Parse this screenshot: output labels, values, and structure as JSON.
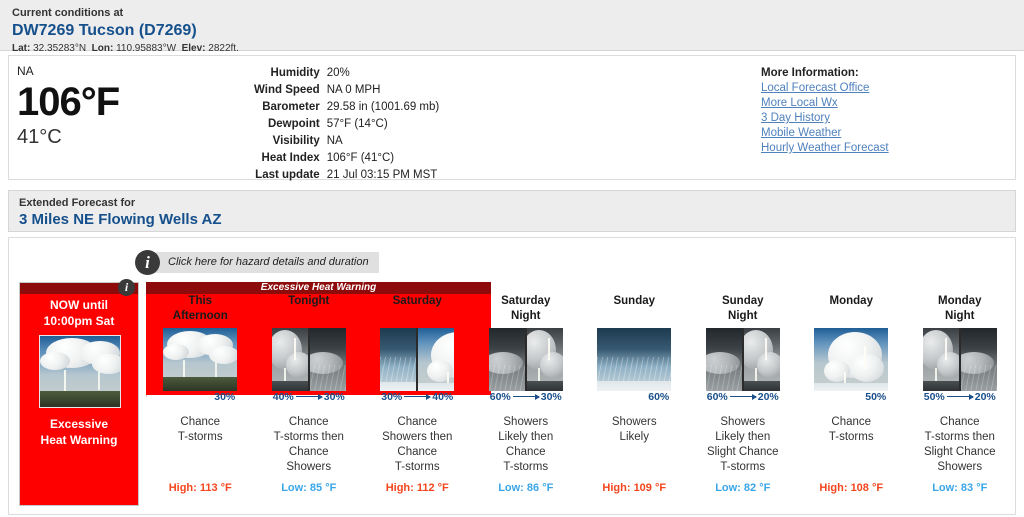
{
  "current": {
    "header_label": "Current conditions at",
    "station": "DW7269 Tucson (D7269)",
    "lat_key": "Lat:",
    "lat_val": "32.35283°N",
    "lon_key": "Lon:",
    "lon_val": "110.95883°W",
    "elev_key": "Elev:",
    "elev_val": "2822ft.",
    "sky": "NA",
    "temp_f": "106°F",
    "temp_c": "41°C",
    "rows": [
      {
        "key": "Humidity",
        "value": "20%"
      },
      {
        "key": "Wind Speed",
        "value": "NA 0 MPH"
      },
      {
        "key": "Barometer",
        "value": "29.58 in (1001.69 mb)"
      },
      {
        "key": "Dewpoint",
        "value": "57°F (14°C)"
      },
      {
        "key": "Visibility",
        "value": "NA"
      },
      {
        "key": "Heat Index",
        "value": "106°F (41°C)"
      },
      {
        "key": "Last update",
        "value": "21 Jul 03:15 PM MST"
      }
    ],
    "more_title": "More Information:",
    "more_links": [
      "Local Forecast Office",
      "More Local Wx",
      "3 Day History",
      "Mobile Weather",
      "Hourly Weather Forecast"
    ]
  },
  "extended": {
    "header_label": "Extended Forecast for",
    "location": "3 Miles NE Flowing Wells AZ",
    "hazard_tip": "Click here for hazard details and duration",
    "hazard_info_icon": "info-icon",
    "warning_card": {
      "when": "NOW until\n10:00pm Sat",
      "when_line1": "NOW until",
      "when_line2": "10:00pm Sat",
      "title_line1": "Excessive",
      "title_line2": "Heat Warning",
      "badge_icon": "info-icon",
      "color": "#fe0000"
    },
    "hazard_band_label": "Excessive Heat Warning",
    "hazard_band_color": "#fe0000",
    "periods": [
      {
        "day_line1": "This",
        "day_line2": "Afternoon",
        "icon": "thunderstorm-day-icon",
        "split": false,
        "pct": "30%",
        "pct2": "",
        "desc_lines": [
          "Chance",
          "T-storms"
        ],
        "temp_label": "High: 113 °F",
        "temp_type": "high"
      },
      {
        "day_line1": "Tonight",
        "day_line2": "",
        "icon": "thunderstorm-night-then-showers-night-icon",
        "split": true,
        "pct": "40%",
        "pct2": "30%",
        "desc_lines": [
          "Chance",
          "T-storms then",
          "Chance",
          "Showers"
        ],
        "temp_label": "Low: 85 °F",
        "temp_type": "low"
      },
      {
        "day_line1": "Saturday",
        "day_line2": "",
        "icon": "showers-day-then-thunderstorm-day-icon",
        "split": true,
        "pct": "30%",
        "pct2": "40%",
        "desc_lines": [
          "Chance",
          "Showers then",
          "Chance",
          "T-storms"
        ],
        "temp_label": "High: 112 °F",
        "temp_type": "high"
      },
      {
        "day_line1": "Saturday",
        "day_line2": "Night",
        "icon": "showers-night-then-thunderstorm-night-icon",
        "split": true,
        "pct": "60%",
        "pct2": "30%",
        "desc_lines": [
          "Showers",
          "Likely then",
          "Chance",
          "T-storms"
        ],
        "temp_label": "Low: 86 °F",
        "temp_type": "low"
      },
      {
        "day_line1": "Sunday",
        "day_line2": "",
        "icon": "showers-day-icon",
        "split": false,
        "pct": "60%",
        "pct2": "",
        "desc_lines": [
          "Showers",
          "Likely"
        ],
        "temp_label": "High: 109 °F",
        "temp_type": "high"
      },
      {
        "day_line1": "Sunday",
        "day_line2": "Night",
        "icon": "showers-night-then-thunderstorm-night-icon",
        "split": true,
        "pct": "60%",
        "pct2": "20%",
        "desc_lines": [
          "Showers",
          "Likely then",
          "Slight Chance",
          "T-storms"
        ],
        "temp_label": "Low: 82 °F",
        "temp_type": "low"
      },
      {
        "day_line1": "Monday",
        "day_line2": "",
        "icon": "thunderstorm-day-icon",
        "split": false,
        "pct": "50%",
        "pct2": "",
        "desc_lines": [
          "Chance",
          "T-storms"
        ],
        "temp_label": "High: 108 °F",
        "temp_type": "high"
      },
      {
        "day_line1": "Monday",
        "day_line2": "Night",
        "icon": "thunderstorm-night-then-showers-night-icon",
        "split": true,
        "pct": "50%",
        "pct2": "20%",
        "desc_lines": [
          "Chance",
          "T-storms then",
          "Slight Chance",
          "Showers"
        ],
        "temp_label": "Low: 83 °F",
        "temp_type": "low"
      }
    ]
  }
}
